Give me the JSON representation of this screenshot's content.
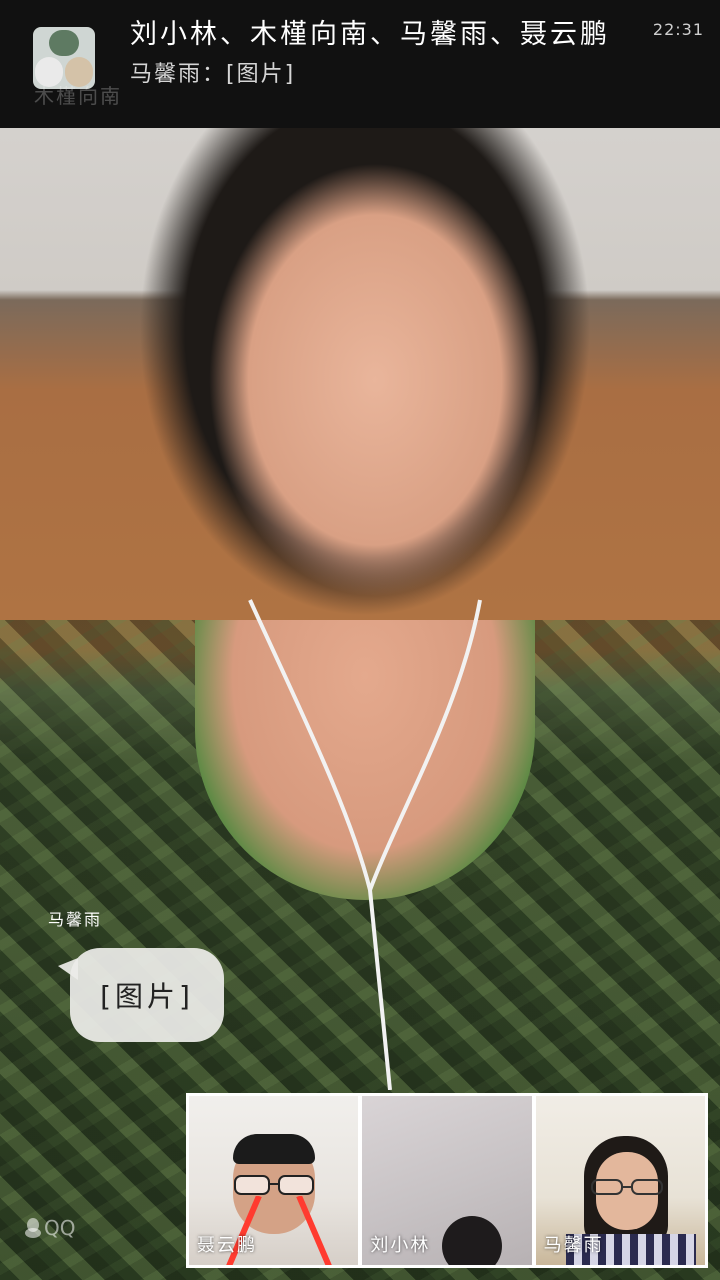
{
  "call": {
    "title": "刘小林、木槿向南、马馨雨、聂云鹏",
    "time": "22:31",
    "last_message": "马馨雨：[图片]",
    "ghost_name": "木槿向南"
  },
  "chat_overlay": {
    "sender": "马馨雨",
    "message": "[图片]"
  },
  "watermark": {
    "label": "QQ"
  },
  "participants": [
    {
      "name": "聂云鹏"
    },
    {
      "name": "刘小林"
    },
    {
      "name": "马馨雨"
    }
  ],
  "colors": {
    "banner_bg": "#111111",
    "bubble_bg": "#ececE8",
    "thumb_border": "#ffffff"
  }
}
